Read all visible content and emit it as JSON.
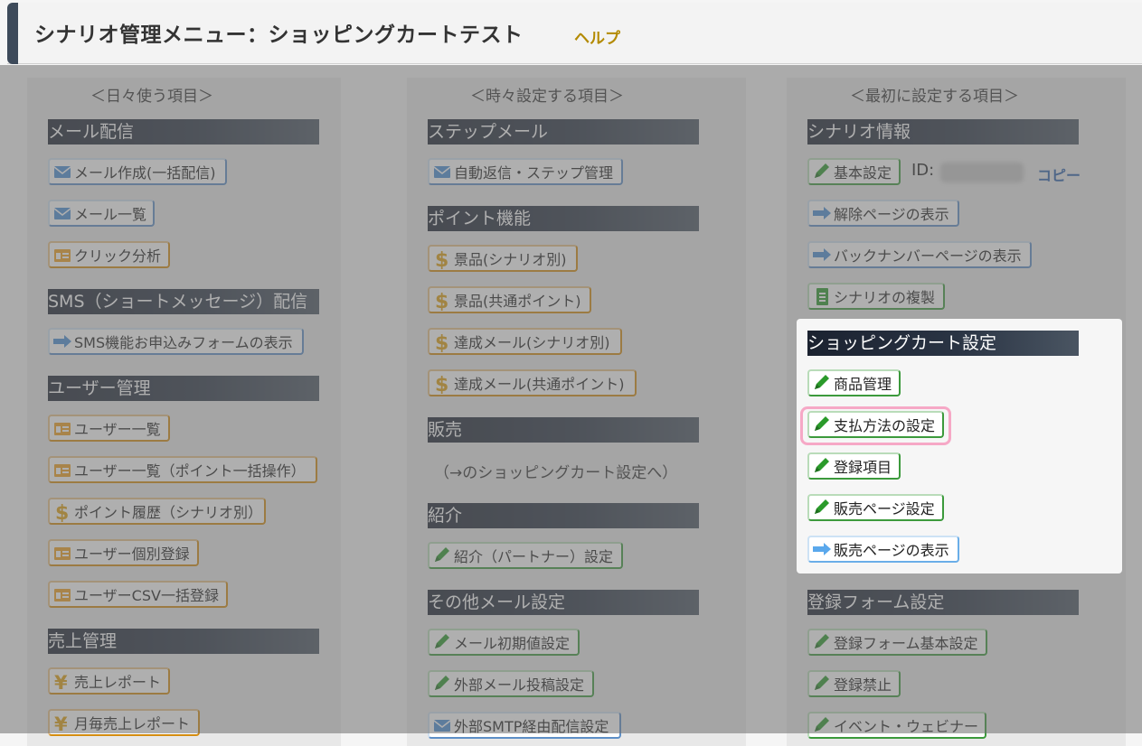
{
  "header": {
    "title": "シナリオ管理メニュー：ショッピングカートテスト",
    "help": "ヘルプ"
  },
  "columns": {
    "daily": {
      "caption": "＜日々使う項目＞",
      "sections": {
        "mail": {
          "title": "メール配信",
          "items": [
            "メール作成(一括配信)",
            "メール一覧",
            "クリック分析"
          ]
        },
        "sms": {
          "title": "SMS（ショートメッセージ）配信",
          "items": [
            "SMS機能お申込みフォームの表示"
          ]
        },
        "users": {
          "title": "ユーザー管理",
          "items": [
            "ユーザー一覧",
            "ユーザー一覧（ポイント一括操作）",
            "ポイント履歴（シナリオ別）",
            "ユーザー個別登録",
            "ユーザーCSV一括登録"
          ]
        },
        "sales": {
          "title": "売上管理",
          "items": [
            "売上レポート",
            "月毎売上レポート"
          ]
        }
      }
    },
    "sometimes": {
      "caption": "＜時々設定する項目＞",
      "sections": {
        "step": {
          "title": "ステップメール",
          "items": [
            "自動返信・ステップ管理"
          ]
        },
        "points": {
          "title": "ポイント機能",
          "items": [
            "景品(シナリオ別)",
            "景品(共通ポイント)",
            "達成メール(シナリオ別)",
            "達成メール(共通ポイント)"
          ]
        },
        "sell": {
          "title": "販売",
          "note": "（→のショッピングカート設定へ）"
        },
        "referral": {
          "title": "紹介",
          "items": [
            "紹介（パートナー）設定"
          ]
        },
        "othermail": {
          "title": "その他メール設定",
          "items": [
            "メール初期値設定",
            "外部メール投稿設定",
            "外部SMTP経由配信設定"
          ]
        }
      }
    },
    "first": {
      "caption": "＜最初に設定する項目＞",
      "sections": {
        "scenario": {
          "title": "シナリオ情報",
          "items": [
            "基本設定",
            "解除ページの表示",
            "バックナンバーページの表示",
            "シナリオの複製"
          ],
          "id_label": "ID:",
          "copy": "コピー"
        },
        "cart": {
          "title": "ショッピングカート設定",
          "items": [
            "商品管理",
            "支払方法の設定",
            "登録項目",
            "販売ページ設定",
            "販売ページの表示"
          ]
        },
        "form": {
          "title": "登録フォーム設定",
          "items": [
            "登録フォーム基本設定",
            "登録禁止",
            "イベント・ウェビナー"
          ]
        }
      }
    }
  },
  "colors": {
    "accent_bar": "#3d4a5a",
    "help": "#b38a00",
    "highlight_ring": "#f6a8c6",
    "copy_link": "#2c5fa8"
  }
}
